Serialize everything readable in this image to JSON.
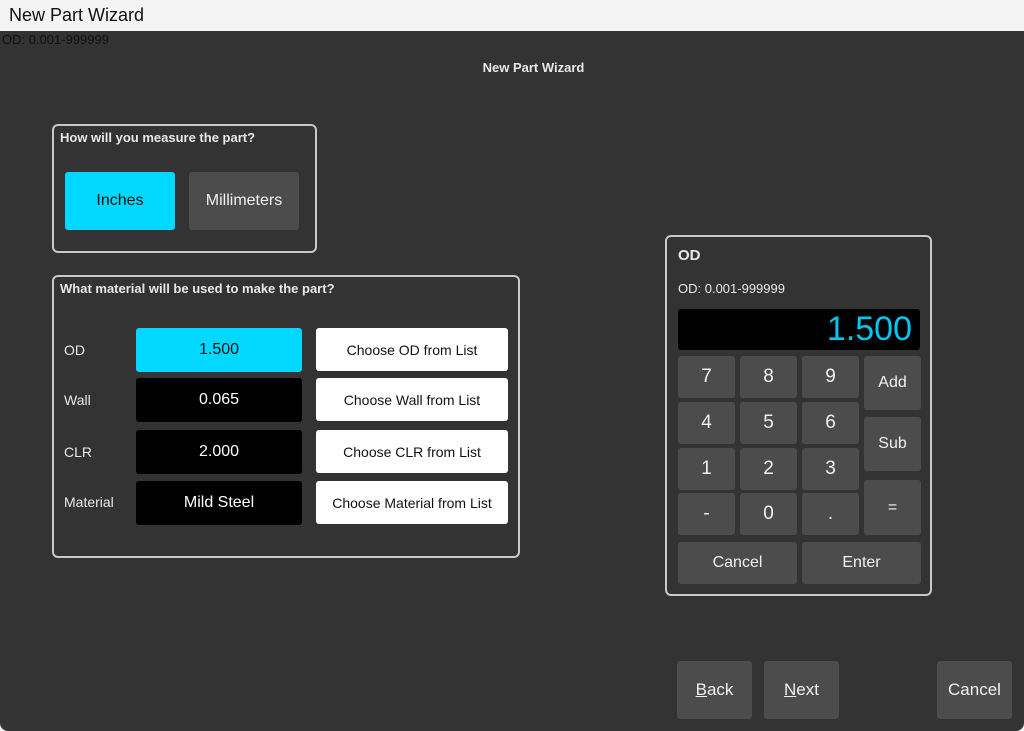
{
  "window": {
    "title": "New Part Wizard"
  },
  "status_text": "OD: 0.001-999999",
  "header": {
    "title": "New Part Wizard"
  },
  "measure_group": {
    "label": "How will you measure the part?",
    "inches_label": "Inches",
    "millimeters_label": "Millimeters"
  },
  "material_group": {
    "label": "What material will be used to make the part?",
    "rows": [
      {
        "label": "OD",
        "value": "1.500",
        "button": "Choose OD from List"
      },
      {
        "label": "Wall",
        "value": "0.065",
        "button": "Choose Wall from List"
      },
      {
        "label": "CLR",
        "value": "2.000",
        "button": "Choose CLR from List"
      },
      {
        "label": "Material",
        "value": "Mild Steel",
        "button": "Choose Material from List"
      }
    ]
  },
  "keypad": {
    "title": "OD",
    "range": "OD: 0.001-999999",
    "display": "1.500",
    "keys": [
      "7",
      "8",
      "9",
      "4",
      "5",
      "6",
      "1",
      "2",
      "3",
      "-",
      "0",
      "."
    ],
    "add_label": "Add",
    "sub_label": "Sub",
    "equals_label": "=",
    "cancel_label": "Cancel",
    "enter_label": "Enter"
  },
  "nav": {
    "back_mnemonic": "B",
    "back_rest": "ack",
    "next_mnemonic": "N",
    "next_rest": "ext",
    "cancel_label": "Cancel"
  },
  "colors": {
    "accent": "#00d8ff",
    "background": "#333333",
    "button": "#4c4c4c"
  }
}
